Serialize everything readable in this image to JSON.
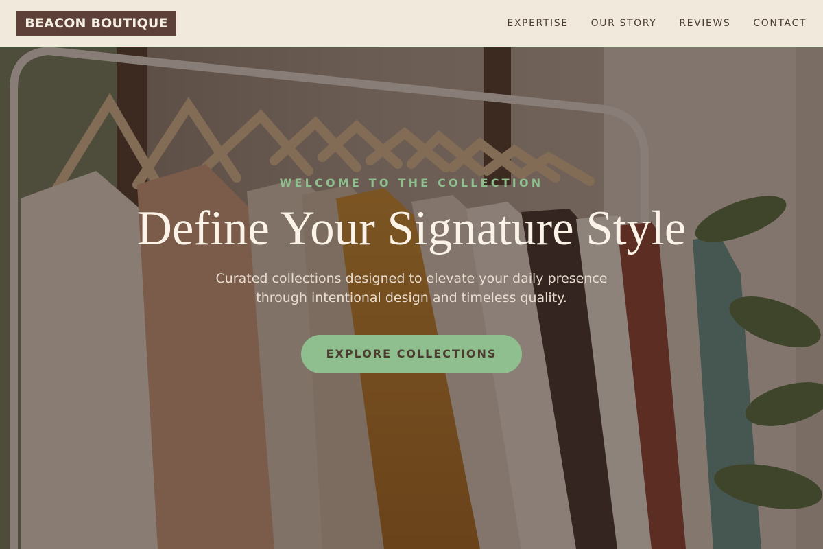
{
  "header": {
    "logo": "BEACON BOUTIQUE",
    "nav": [
      {
        "label": "EXPERTISE"
      },
      {
        "label": "OUR STORY"
      },
      {
        "label": "REVIEWS"
      },
      {
        "label": "CONTACT"
      }
    ]
  },
  "hero": {
    "eyebrow": "WELCOME TO THE COLLECTION",
    "headline": "Define Your Signature Style",
    "subtext": "Curated collections designed to elevate your daily presence through intentional design and timeless quality.",
    "cta_label": "EXPLORE COLLECTIONS"
  },
  "colors": {
    "header_bg": "#f0e9dc",
    "logo_bg": "#5d4037",
    "accent_green": "#8fbf8e",
    "headline_text": "#fbf3e7"
  }
}
